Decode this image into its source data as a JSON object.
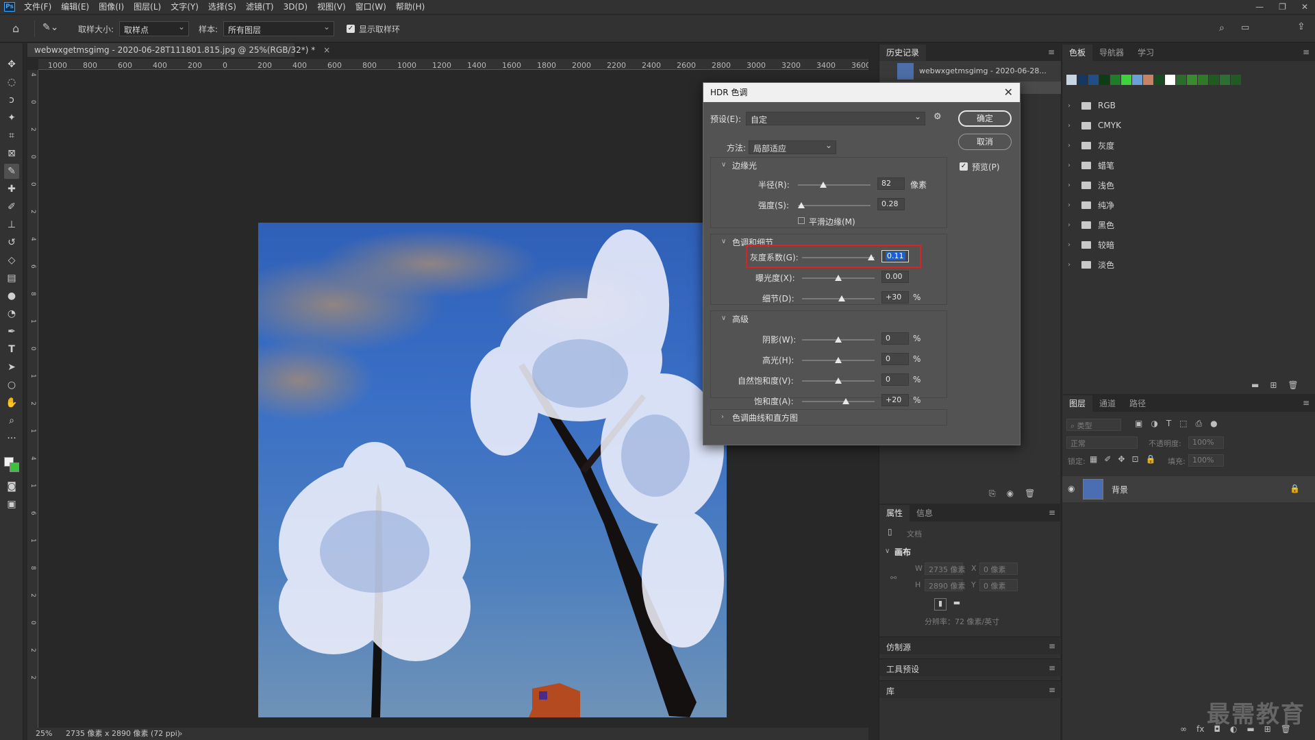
{
  "menu": {
    "logo": "Ps",
    "items": [
      "文件(F)",
      "编辑(E)",
      "图像(I)",
      "图层(L)",
      "文字(Y)",
      "选择(S)",
      "滤镜(T)",
      "3D(D)",
      "视图(V)",
      "窗口(W)",
      "帮助(H)"
    ],
    "win_min": "—",
    "win_restore": "❐",
    "win_close": "✕"
  },
  "options": {
    "sample_size_label": "取样大小:",
    "sample_size_value": "取样点",
    "sample_label": "样本:",
    "sample_value": "所有图层",
    "show_ring_label": "显示取样环"
  },
  "document": {
    "tab_title": "webwxgetmsgimg - 2020-06-28T111801.815.jpg @ 25%(RGB/32*) *",
    "tab_close": "×",
    "ruler_h": [
      "1000",
      "800",
      "600",
      "400",
      "200",
      "0",
      "200",
      "400",
      "600",
      "800",
      "1000",
      "1200",
      "1400",
      "1600",
      "1800",
      "2000",
      "2200",
      "2400",
      "2600",
      "2800",
      "3000",
      "3200",
      "3400",
      "3600"
    ],
    "ruler_v": [
      "4",
      "0",
      "2",
      "0",
      "0",
      "2",
      "4",
      "6",
      "8",
      "1",
      "0",
      "1",
      "2",
      "1",
      "4",
      "1",
      "6",
      "1",
      "8",
      "2",
      "0",
      "2",
      "2"
    ],
    "zoom": "25%",
    "status": "2735 像素 x 2890 像素 (72 ppi)",
    "status_arrow": "›"
  },
  "history": {
    "tabs": [
      "历史记录"
    ],
    "snapshot_name": "webwxgetmsgimg - 2020-06-28...",
    "footer_icons": [
      "new-snapshot-icon",
      "camera-icon",
      "trash-icon"
    ]
  },
  "properties": {
    "tabs": [
      "属性",
      "信息"
    ],
    "doc_label": "文档",
    "canvas_section": "画布",
    "w_label": "W",
    "w_value": "2735 像素",
    "h_label": "H",
    "h_value": "2890 像素",
    "x_label": "X",
    "x_value": "0 像素",
    "y_label": "Y",
    "y_value": "0 像素",
    "resolution": "分辨率：72 像素/英寸"
  },
  "collapsed_panels": [
    "仿制源",
    "工具预设",
    "库"
  ],
  "swatches": {
    "tabs": [
      "色板",
      "导航器",
      "学习"
    ],
    "recent_colors": [
      "#c9d4e3",
      "#16375f",
      "#1f4f86",
      "#0d3d14",
      "#1f7d2a",
      "#3dd43b",
      "#6a9fd8",
      "#c88264",
      "#1a4a1f",
      "#ffffff",
      "#2b6b2b",
      "#3b8a2e",
      "#2f7a26",
      "#1f5b1f",
      "#2b7030",
      "#215a25"
    ],
    "folders": [
      "RGB",
      "CMYK",
      "灰度",
      "蜡笔",
      "浅色",
      "纯净",
      "黑色",
      "较暗",
      "淡色"
    ]
  },
  "layers": {
    "tabs": [
      "图层",
      "通道",
      "路径"
    ],
    "filter_placeholder": "类型",
    "blend_mode": "正常",
    "opacity_label": "不透明度:",
    "opacity_value": "100%",
    "lock_label": "锁定:",
    "fill_label": "填充:",
    "fill_value": "100%",
    "layer_name": "背景"
  },
  "dialog": {
    "title": "HDR 色调",
    "close": "✕",
    "preset_label": "预设(E):",
    "preset_value": "自定",
    "method_label": "方法:",
    "method_value": "局部适应",
    "ok": "确定",
    "cancel": "取消",
    "preview_label": "预览(P)",
    "edge_glow": {
      "title": "边缘光",
      "radius_label": "半径(R):",
      "radius_value": "82",
      "radius_unit": "像素",
      "radius_pos": 0.35,
      "strength_label": "强度(S):",
      "strength_value": "0.28",
      "strength_pos": 0.05,
      "smooth_label": "平滑边缘(M)"
    },
    "tone_detail": {
      "title": "色调和细节",
      "gamma_label": "灰度系数(G):",
      "gamma_value": "0.11",
      "gamma_pos": 0.95,
      "exposure_label": "曝光度(X):",
      "exposure_value": "0.00",
      "exposure_pos": 0.5,
      "detail_label": "细节(D):",
      "detail_value": "+30",
      "detail_unit": "%",
      "detail_pos": 0.55
    },
    "advanced": {
      "title": "高级",
      "shadow_label": "阴影(W):",
      "shadow_value": "0",
      "shadow_unit": "%",
      "shadow_pos": 0.5,
      "highlight_label": "高光(H):",
      "highlight_value": "0",
      "highlight_unit": "%",
      "highlight_pos": 0.5,
      "vibrance_label": "自然饱和度(V):",
      "vibrance_value": "0",
      "vibrance_unit": "%",
      "vibrance_pos": 0.5,
      "saturation_label": "饱和度(A):",
      "saturation_value": "+20",
      "saturation_unit": "%",
      "saturation_pos": 0.6
    },
    "curve_section": "色调曲线和直方图"
  },
  "watermark": "最需教育",
  "colors": {
    "highlight_box": "#e02020",
    "selected_field": "#1a5fd6"
  }
}
